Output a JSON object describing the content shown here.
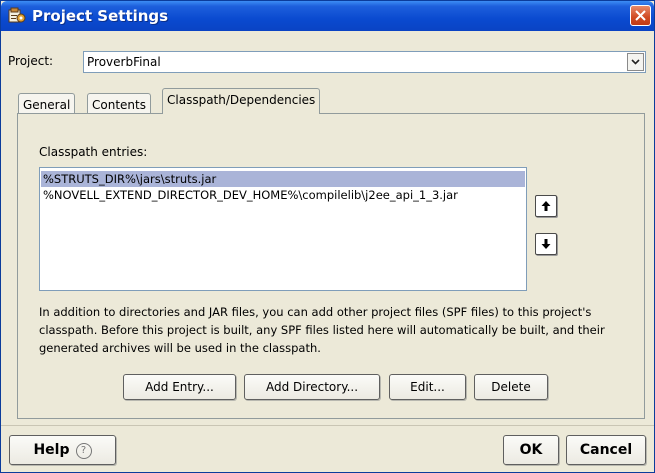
{
  "window": {
    "title": "Project Settings",
    "icon": "project-settings-icon",
    "close_icon": "close-icon",
    "colors": {
      "titlebar": "#0a4ad0",
      "close": "#d04a22",
      "selection": "#aab4d8"
    }
  },
  "project": {
    "label": "Project:",
    "value": "ProverbFinal"
  },
  "tabs": [
    {
      "label": "General",
      "active": false
    },
    {
      "label": "Contents",
      "active": false
    },
    {
      "label": "Classpath/Dependencies",
      "active": true
    }
  ],
  "classpath": {
    "label": "Classpath entries:",
    "entries": [
      {
        "path": "%STRUTS_DIR%\\jars\\struts.jar",
        "selected": true
      },
      {
        "path": "%NOVELL_EXTEND_DIRECTOR_DEV_HOME%\\compilelib\\j2ee_api_1_3.jar",
        "selected": false
      }
    ],
    "move_up_icon": "arrow-up-icon",
    "move_down_icon": "arrow-down-icon",
    "description": "In addition to directories and JAR files, you can add other project files (SPF files) to this project's classpath. Before this project is built, any SPF files listed here will automatically be built, and their generated archives will be used in the classpath."
  },
  "actions": {
    "add_entry": "Add Entry...",
    "add_directory": "Add Directory...",
    "edit": "Edit...",
    "delete": "Delete"
  },
  "footer": {
    "help": "Help",
    "help_icon": "question-circle-icon",
    "ok": "OK",
    "cancel": "Cancel"
  }
}
